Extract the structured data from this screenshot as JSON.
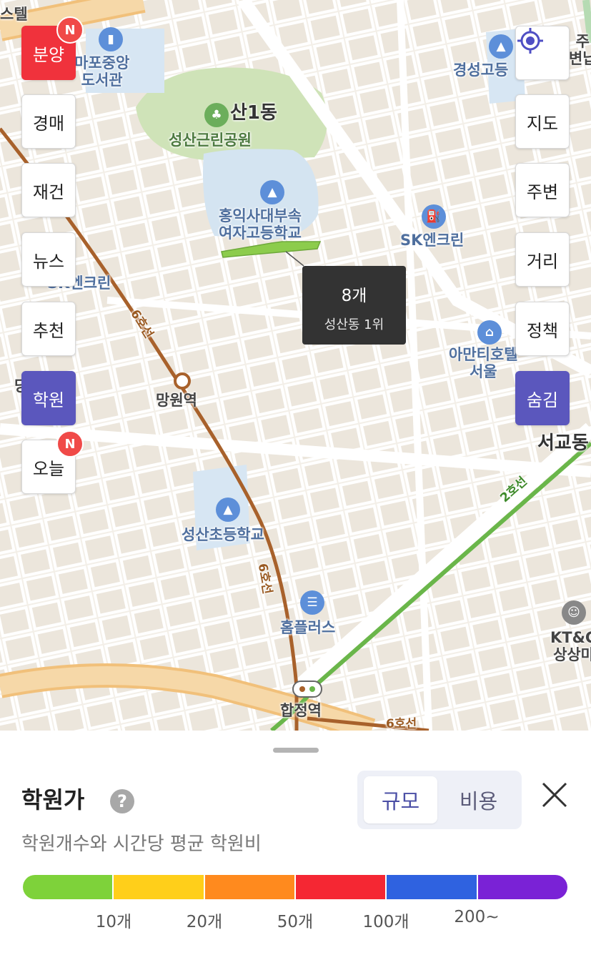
{
  "map": {
    "labels": {
      "hotel_partial": "스텔",
      "library": "마포중앙\n도서관",
      "gyeongseong": "경성고등",
      "station_partial": "주\n변납",
      "park_area": "산1동",
      "park": "성산근린공원",
      "hongik_school": "홍익사대부속\n여자고등학교",
      "sk_gas": "SK엔크린",
      "gas_left": "SK엔크린",
      "line6_a": "6호선",
      "mangwon": "망원역",
      "amanti": "아만티호텔\n서울",
      "seogyo": "서교동",
      "line2": "2호선",
      "seongsan_elem": "성산초등학교",
      "line6_b": "6호선",
      "homeplus": "홈플러스",
      "ktng": "KT&G\n상상마",
      "hapjeong": "합정역",
      "line6_c": "6호선",
      "left_partial": "당"
    }
  },
  "left_menu": [
    {
      "label": "분양",
      "style": "red",
      "badge": "N"
    },
    {
      "label": "경매",
      "style": "normal",
      "badge": ""
    },
    {
      "label": "재건",
      "style": "normal",
      "badge": ""
    },
    {
      "label": "뉴스",
      "style": "normal",
      "badge": ""
    },
    {
      "label": "추천",
      "style": "normal",
      "badge": ""
    },
    {
      "label": "학원",
      "style": "purple",
      "badge": ""
    },
    {
      "label": "오늘",
      "style": "normal",
      "badge": "N"
    }
  ],
  "right_menu": [
    {
      "label": "지도",
      "style": "normal"
    },
    {
      "label": "주변",
      "style": "normal"
    },
    {
      "label": "거리",
      "style": "normal"
    },
    {
      "label": "정책",
      "style": "normal"
    },
    {
      "label": "숨김",
      "style": "purple"
    }
  ],
  "tooltip": {
    "count": "8개",
    "rank": "성산동 1위"
  },
  "panel": {
    "title": "학원가",
    "help": "?",
    "subtitle": "학원개수와 시간당 평균 학원비",
    "toggle": [
      {
        "label": "규모",
        "active": true
      },
      {
        "label": "비용",
        "active": false
      }
    ],
    "legend": {
      "colors": [
        "#7ed23a",
        "#ffcf1a",
        "#ff8a1e",
        "#f52733",
        "#2f62e0",
        "#7a22d6"
      ],
      "ticks": [
        "10개",
        "20개",
        "50개",
        "100개",
        "200~"
      ]
    }
  }
}
